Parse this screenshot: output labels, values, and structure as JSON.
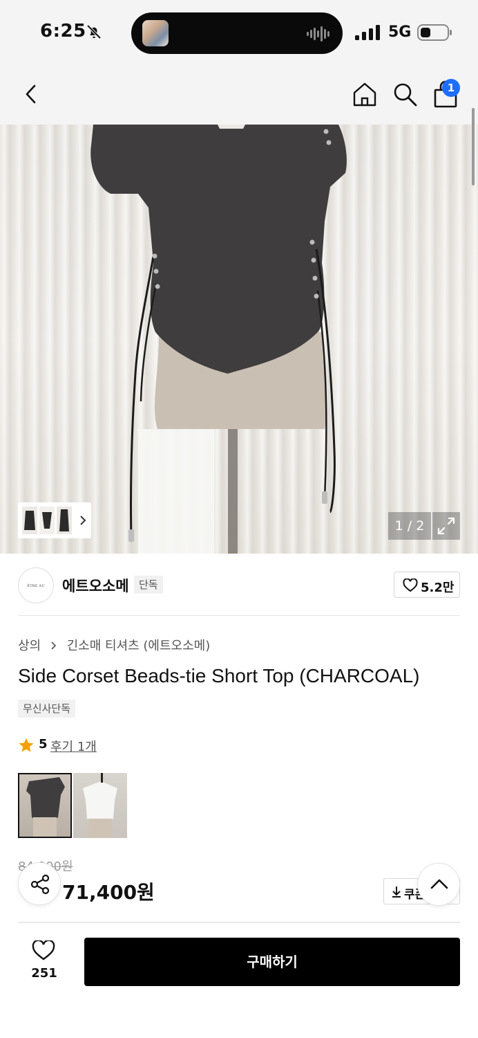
{
  "status_bar": {
    "time": "6:25",
    "network": "5G",
    "icons": [
      "bell-slash-icon",
      "audio-wave-icon",
      "signal-icon",
      "battery-icon"
    ]
  },
  "nav": {
    "icons": [
      "back-chevron-icon",
      "home-icon",
      "search-icon",
      "cart-icon"
    ],
    "cart_count": "1"
  },
  "gallery": {
    "counter": "1 / 2",
    "icons": [
      "expand-icon",
      "chevron-right-icon"
    ]
  },
  "brand": {
    "logo_text": "ÊTRE AU SOMMET",
    "name": "에트오소메",
    "tag": "단독",
    "likes": "5.2만"
  },
  "breadcrumb": [
    "상의",
    "긴소매 티셔츠 (에트오소메)"
  ],
  "product": {
    "title": "Side Corset Beads-tie Short Top (CHARCOAL)",
    "badge": "무신사단독",
    "rating": "5",
    "review_link": "후기 1개",
    "swatches": [
      "charcoal",
      "white"
    ],
    "price_original": "84,000원",
    "price_sale": "71,400원",
    "coupon_label": "쿠폰"
  },
  "bottom_bar": {
    "wish_count": "251",
    "buy_label": "구매하기"
  },
  "colors": {
    "accent": "#1e6dff",
    "star": "#f5a000",
    "buy_button": "#000000",
    "garment": "#3f3d3e"
  }
}
